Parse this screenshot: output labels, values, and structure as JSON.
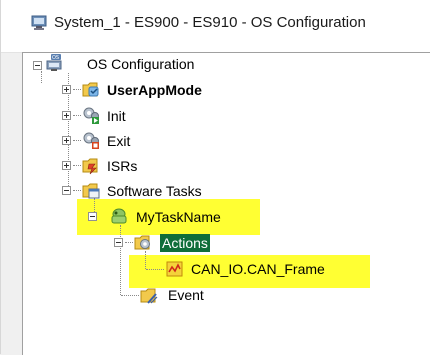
{
  "window": {
    "title": "System_1 - ES900 - ES910 - OS Configuration",
    "title_icon": "system-config-icon"
  },
  "tree": {
    "root": {
      "label": "OS Configuration",
      "icon": "os-config-icon",
      "expanded": true
    },
    "items": [
      {
        "label": "UserAppMode",
        "icon": "folder-appmode-icon",
        "bold": true,
        "expanded": false
      },
      {
        "label": "Init",
        "icon": "gears-init-icon",
        "expanded": false
      },
      {
        "label": "Exit",
        "icon": "gears-exit-icon",
        "expanded": false
      },
      {
        "label": "ISRs",
        "icon": "folder-isr-icon",
        "expanded": false
      },
      {
        "label": "Software Tasks",
        "icon": "folder-tasks-icon",
        "expanded": true
      }
    ],
    "task": {
      "label": "MyTaskName",
      "icon": "task-icon",
      "expanded": true
    },
    "actions": {
      "label": "Actions",
      "icon": "folder-actions-icon",
      "expanded": true,
      "selected": true
    },
    "frame": {
      "label": "CAN_IO.CAN_Frame",
      "icon": "can-frame-icon"
    },
    "event": {
      "label": "Event",
      "icon": "folder-event-icon"
    }
  },
  "colors": {
    "highlight": "#ffff33",
    "selection": "#0f6e3a"
  }
}
